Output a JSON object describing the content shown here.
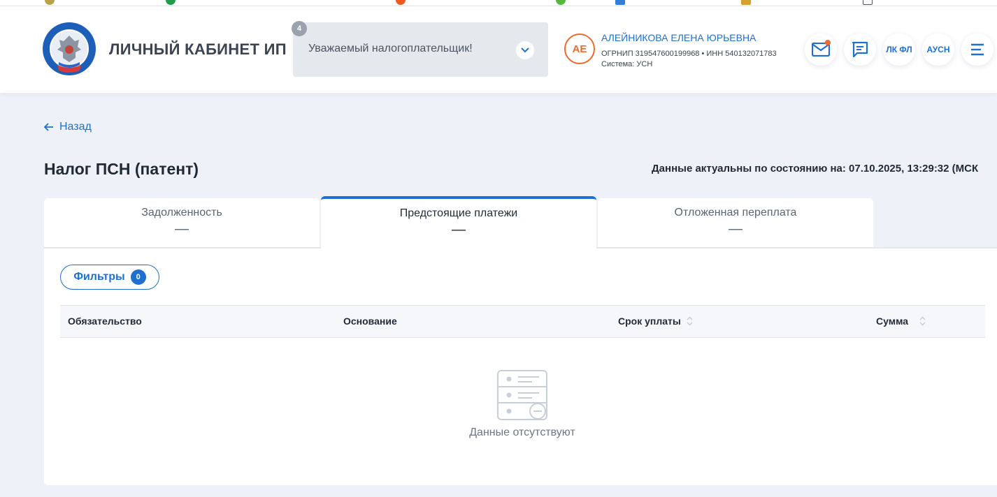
{
  "header": {
    "brand": "ЛИЧНЫЙ КАБИНЕТ ИП",
    "notice": {
      "count": "4",
      "text": "Уважаемый налогоплательщик!"
    },
    "user": {
      "initials": "АЕ",
      "name": "АЛЕЙНИКОВА ЕЛЕНА ЮРЬЕВНА",
      "ids": "ОГРНИП 319547600199968 • ИНН 540132071783",
      "system": "Система: УСН"
    },
    "actions": {
      "lkfl": "ЛК ФЛ",
      "ausn": "АУСН"
    }
  },
  "nav": {
    "back": "Назад"
  },
  "page": {
    "title": "Налог ПСН (патент)",
    "status": "Данные актуальны по состоянию на: 07.10.2025, 13:29:32 (МСК"
  },
  "tabs": [
    {
      "label": "Задолженность",
      "value": "—"
    },
    {
      "label": "Предстоящие платежи",
      "value": "—"
    },
    {
      "label": "Отложенная переплата",
      "value": "—"
    }
  ],
  "filters": {
    "label": "Фильтры",
    "count": "0"
  },
  "table": {
    "columns": [
      "Обязательство",
      "Основание",
      "Срок уплаты",
      "Сумма"
    ],
    "empty_text": "Данные отсутствуют"
  },
  "colors": {
    "accent": "#1f6fd1",
    "avatar": "#ef6a2a",
    "background": "#eef2f8"
  }
}
